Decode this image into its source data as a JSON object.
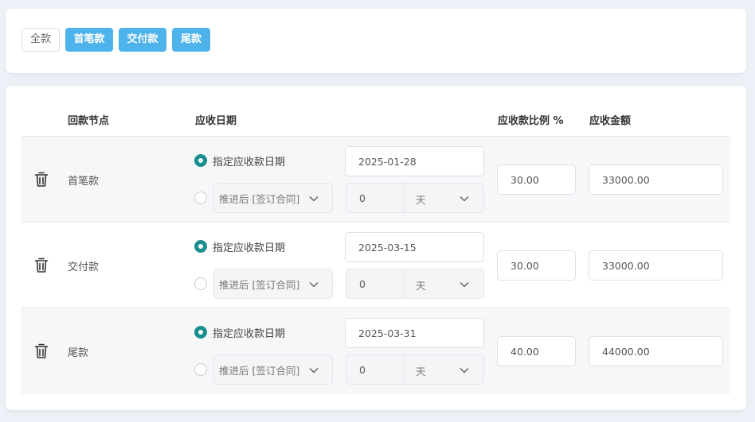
{
  "filter_tags": [
    {
      "label": "全款",
      "active": false
    },
    {
      "label": "首笔款",
      "active": true
    },
    {
      "label": "交付款",
      "active": true
    },
    {
      "label": "尾款",
      "active": true
    }
  ],
  "table": {
    "headers": {
      "node": "回款节点",
      "date": "应收日期",
      "ratio": "应收款比例 %",
      "amount": "应收金额"
    },
    "rows": [
      {
        "node": "首笔款",
        "date_option_label": "指定应收款日期",
        "date_value": "2025-01-28",
        "defer_select": "推进后 [签订合同]",
        "defer_count": "0",
        "defer_unit": "天",
        "ratio": "30.00",
        "amount": "33000.00"
      },
      {
        "node": "交付款",
        "date_option_label": "指定应收款日期",
        "date_value": "2025-03-15",
        "defer_select": "推进后 [签订合同]",
        "defer_count": "0",
        "defer_unit": "天",
        "ratio": "30.00",
        "amount": "33000.00"
      },
      {
        "node": "尾款",
        "date_option_label": "指定应收款日期",
        "date_value": "2025-03-31",
        "defer_select": "推进后 [签订合同]",
        "defer_count": "0",
        "defer_unit": "天",
        "ratio": "40.00",
        "amount": "44000.00"
      }
    ]
  },
  "colors": {
    "accent": "#4db3ea",
    "radio_checked": "#1a8f8f",
    "page_bg": "#edf1f7"
  },
  "icons": {
    "delete": "trash-icon",
    "dropdown": "chevron-down-icon"
  }
}
